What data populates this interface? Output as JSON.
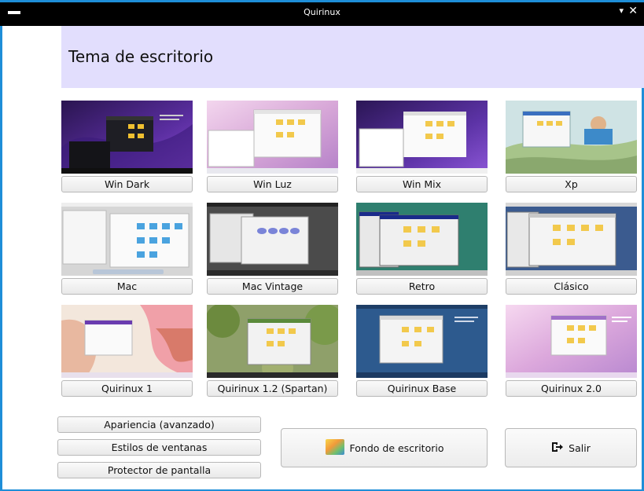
{
  "window": {
    "title": "Quirinux"
  },
  "header": {
    "title": "Tema de escritorio"
  },
  "themes": [
    {
      "label": "Win Dark"
    },
    {
      "label": "Win Luz"
    },
    {
      "label": "Win Mix"
    },
    {
      "label": "Xp"
    },
    {
      "label": "Mac"
    },
    {
      "label": "Mac Vintage"
    },
    {
      "label": "Retro"
    },
    {
      "label": "Clásico"
    },
    {
      "label": "Quirinux 1"
    },
    {
      "label": "Quirinux 1.2 (Spartan)"
    },
    {
      "label": "Quirinux Base"
    },
    {
      "label": "Quirinux 2.0"
    }
  ],
  "settings": {
    "appearance": "Apariencia (avanzado)",
    "window_styles": "Estilos de ventanas",
    "screensaver": "Protector de pantalla"
  },
  "wallpaper_button": "Fondo de escritorio",
  "exit_button": "Salir",
  "icons": {
    "menu": "menu-icon",
    "dropdown": "chevron-down-icon",
    "close": "close-icon",
    "wallpaper": "wallpaper-icon",
    "exit": "exit-icon"
  },
  "colors": {
    "accent": "#1e8ed8",
    "header_bg": "#e2defd",
    "titlebar_bg": "#000000"
  }
}
